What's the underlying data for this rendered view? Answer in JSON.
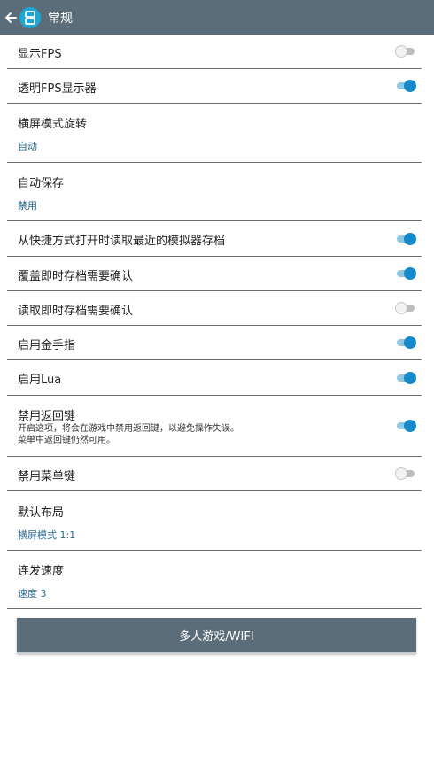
{
  "header": {
    "title": "常规",
    "back_icon": "arrow-left-icon",
    "app_icon": "emulator-app-icon",
    "bar_color": "#5b6d78",
    "icon_color": "#1fa7d4"
  },
  "settings": [
    {
      "title": "显示FPS",
      "toggle": false
    },
    {
      "title": "透明FPS显示器",
      "toggle": true
    },
    {
      "title": "横屏模式旋转",
      "value": "自动"
    },
    {
      "title": "自动保存",
      "value": "禁用"
    },
    {
      "title": "从快捷方式打开时读取最近的模拟器存档",
      "toggle": true
    },
    {
      "title": "覆盖即时存档需要确认",
      "toggle": true
    },
    {
      "title": "读取即时存档需要确认",
      "toggle": false
    },
    {
      "title": "启用金手指",
      "toggle": true
    },
    {
      "title": "启用Lua",
      "toggle": true
    },
    {
      "title": "禁用返回键",
      "toggle": true,
      "desc_line1": "开启这项，将会在游戏中禁用返回键，以避免操作失误。",
      "desc_line2": "菜单中返回键仍然可用。"
    },
    {
      "title": "禁用菜单键",
      "toggle": false
    },
    {
      "title": "默认布局",
      "value": "横屏模式 1:1"
    },
    {
      "title": "连发速度",
      "value": "速度 3"
    }
  ],
  "wifi_button": {
    "label": "多人游戏/WIFI"
  },
  "colors": {
    "toggle_on": "#1689c9",
    "value_text": "#2a6a8e"
  }
}
